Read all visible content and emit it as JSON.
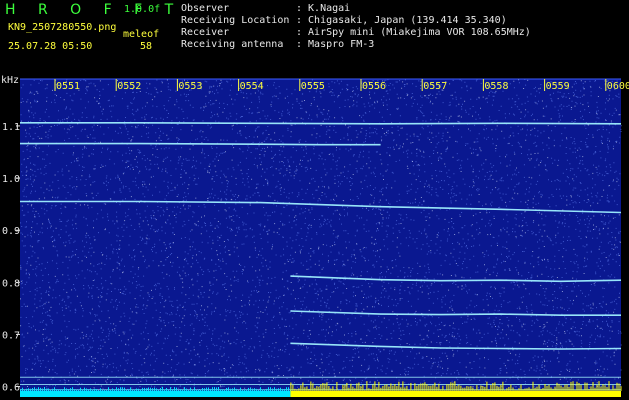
{
  "header": {
    "logo": "H R O F F T",
    "version": "1.0.0f",
    "filename": "KN9_2507280550.png",
    "datetime": "25.07.28 05:50",
    "meleof_label": "meleof",
    "meleof_value": "58"
  },
  "info": [
    {
      "key": "Observer",
      "value": ": K.Nagai"
    },
    {
      "key": "Receiving Location",
      "value": ": Chigasaki, Japan (139.414 35.340)"
    },
    {
      "key": "Receiver",
      "value": ": AirSpy mini (Miakejima VOR 108.65MHz)"
    },
    {
      "key": "Receiving antenna",
      "value": ": Maspro FM-3"
    }
  ],
  "colors": {
    "background": "#000000",
    "waterfall": "#0a1890",
    "trace": "#9ff0ff",
    "green_text": "#3cff3c",
    "yellow_time": "#ffff3c",
    "bottom_cyan": "#00e5ff",
    "bottom_yellow": "#ffff00"
  },
  "chart_data": {
    "type": "heatmap",
    "ylabel": "kHz",
    "x_ticks": [
      "0551",
      "0552",
      "0553",
      "0554",
      "0555",
      "0556",
      "0557",
      "0558",
      "0559",
      "0600"
    ],
    "y_ticks": [
      1.1,
      1.0,
      0.9,
      0.8,
      0.7,
      0.6
    ],
    "ylim": [
      0.58,
      1.19
    ],
    "xlim": [
      0,
      10
    ],
    "grid": false,
    "series": [
      {
        "x": [
          0,
          2,
          4,
          6,
          8,
          10
        ],
        "y": [
          1.106,
          1.106,
          1.105,
          1.104,
          1.105,
          1.104
        ]
      },
      {
        "x": [
          0,
          2,
          4,
          5,
          6
        ],
        "y": [
          1.066,
          1.066,
          1.065,
          1.064,
          1.064
        ]
      },
      {
        "x": [
          0,
          2,
          4,
          6,
          8,
          10
        ],
        "y": [
          0.955,
          0.955,
          0.953,
          0.945,
          0.94,
          0.934
        ]
      },
      {
        "x": [
          4.5,
          6,
          7,
          8,
          9,
          10
        ],
        "y": [
          0.812,
          0.805,
          0.803,
          0.804,
          0.802,
          0.804
        ]
      },
      {
        "x": [
          4.5,
          6,
          7,
          8,
          9,
          10
        ],
        "y": [
          0.745,
          0.739,
          0.738,
          0.739,
          0.737,
          0.737
        ]
      },
      {
        "x": [
          4.5,
          6,
          7,
          8,
          9,
          10
        ],
        "y": [
          0.683,
          0.677,
          0.674,
          0.673,
          0.672,
          0.673
        ]
      },
      {
        "x": [
          0,
          10
        ],
        "y": [
          0.618,
          0.618
        ]
      },
      {
        "x": [
          0,
          10
        ],
        "y": [
          0.604,
          0.604
        ]
      },
      {
        "x": [
          0,
          10
        ],
        "y": [
          0.594,
          0.594
        ]
      }
    ],
    "bottom_strip": [
      {
        "x_start": 0,
        "x_end": 4.5,
        "color": "cyan"
      },
      {
        "x_start": 4.5,
        "x_end": 10,
        "color": "yellow"
      }
    ]
  }
}
